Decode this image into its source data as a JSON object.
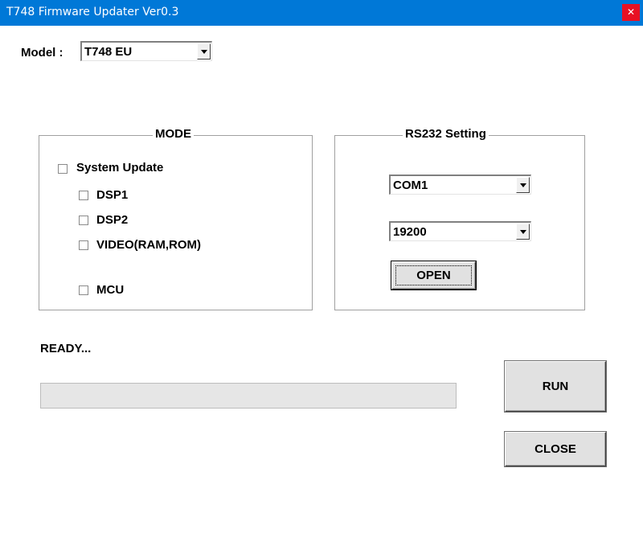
{
  "window": {
    "title": "T748 Firmware Updater Ver0.3",
    "close_glyph": "✕"
  },
  "model": {
    "label": "Model :",
    "selected": "T748 EU"
  },
  "mode": {
    "title": "MODE",
    "system_update": {
      "label": "System Update",
      "checked": false
    },
    "dsp1": {
      "label": "DSP1",
      "checked": false
    },
    "dsp2": {
      "label": "DSP2",
      "checked": false
    },
    "video": {
      "label": "VIDEO(RAM,ROM)",
      "checked": false
    },
    "mcu": {
      "label": "MCU",
      "checked": false
    }
  },
  "rs232": {
    "title": "RS232 Setting",
    "port": "COM1",
    "baud": "19200",
    "open_label": "OPEN"
  },
  "status": {
    "text": "READY..."
  },
  "progress": {
    "percent": 0
  },
  "buttons": {
    "run_label": "RUN",
    "close_label": "CLOSE"
  },
  "colors": {
    "titlebar": "#0078d7",
    "close_button": "#e81123"
  }
}
